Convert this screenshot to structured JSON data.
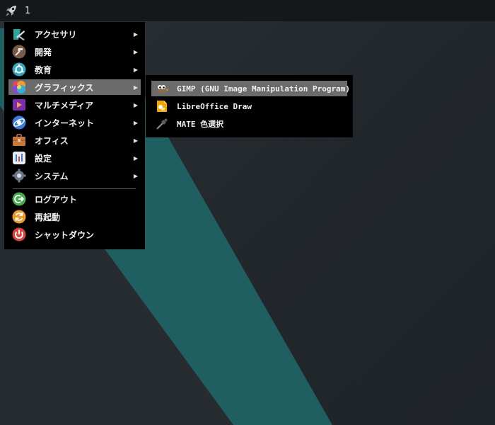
{
  "panel": {
    "workspace": "1",
    "menu_icon": "rocket-icon"
  },
  "menu": {
    "items": [
      {
        "label": "アクセサリ",
        "icon": "accessories-icon",
        "has_submenu": true
      },
      {
        "label": "開発",
        "icon": "development-icon",
        "has_submenu": true
      },
      {
        "label": "教育",
        "icon": "education-icon",
        "has_submenu": true
      },
      {
        "label": "グラフィックス",
        "icon": "graphics-icon",
        "has_submenu": true,
        "selected": true
      },
      {
        "label": "マルチメディア",
        "icon": "multimedia-icon",
        "has_submenu": true
      },
      {
        "label": "インターネット",
        "icon": "internet-icon",
        "has_submenu": true
      },
      {
        "label": "オフィス",
        "icon": "office-icon",
        "has_submenu": true
      },
      {
        "label": "設定",
        "icon": "settings-icon",
        "has_submenu": true
      },
      {
        "label": "システム",
        "icon": "system-icon",
        "has_submenu": true
      }
    ],
    "session": [
      {
        "label": "ログアウト",
        "icon": "logout-icon"
      },
      {
        "label": "再起動",
        "icon": "restart-icon"
      },
      {
        "label": "シャットダウン",
        "icon": "shutdown-icon"
      }
    ],
    "arrow_glyph": "▶"
  },
  "submenu": {
    "items": [
      {
        "label": "GIMP (GNU Image Manipulation Program)",
        "icon": "gimp-icon",
        "selected": true
      },
      {
        "label": "LibreOffice Draw",
        "icon": "libreoffice-draw-icon"
      },
      {
        "label": "MATE 色選択",
        "icon": "color-picker-icon"
      }
    ]
  },
  "colors": {
    "menu_bg": "#000000",
    "highlight": "#6b6b6b",
    "panel_bg": "#15181b",
    "desktop_bg": "#23282d",
    "accent_teal": "#1f5f62"
  }
}
